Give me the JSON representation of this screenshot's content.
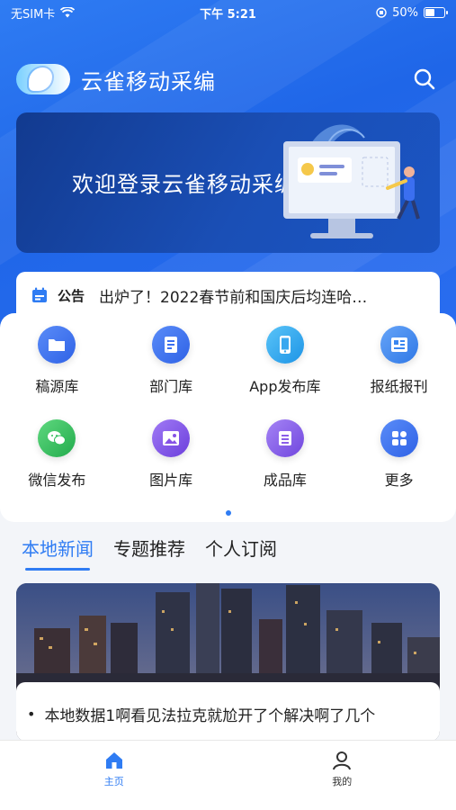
{
  "status_bar": {
    "carrier": "无SIM卡",
    "time": "下午 5:21",
    "battery": "50%",
    "battery_level": 0.5
  },
  "header": {
    "title": "云雀移动采编",
    "logo_icon": "lark-bird-logo",
    "search_icon": "search-icon"
  },
  "banner": {
    "text": "欢迎登录云雀移动采编"
  },
  "notice": {
    "tag": "公告",
    "text": "出炉了！2022春节前和国庆后均连哈…"
  },
  "grid": {
    "items": [
      {
        "label": "稿源库",
        "icon": "folder-icon",
        "color": "#3b6ff0"
      },
      {
        "label": "部门库",
        "icon": "document-icon",
        "color": "#3b6ff0"
      },
      {
        "label": "App发布库",
        "icon": "phone-icon",
        "color": "#2da5ee"
      },
      {
        "label": "报纸报刊",
        "icon": "newspaper-icon",
        "color": "#3a86f0"
      },
      {
        "label": "微信发布",
        "icon": "wechat-icon",
        "color": "#2fbd5a"
      },
      {
        "label": "图片库",
        "icon": "image-icon",
        "color": "#8652e6"
      },
      {
        "label": "成品库",
        "icon": "archive-icon",
        "color": "#8a5ee8"
      },
      {
        "label": "更多",
        "icon": "more-grid-icon",
        "color": "#3b6ff0"
      }
    ]
  },
  "tabs": [
    {
      "label": "本地新闻",
      "active": true
    },
    {
      "label": "专题推荐",
      "active": false
    },
    {
      "label": "个人订阅",
      "active": false
    }
  ],
  "news": {
    "bullet": "•",
    "title": "本地数据1啊看见法拉克就尬开了个解决啊了几个"
  },
  "bottom_nav": [
    {
      "label": "主页",
      "icon": "home-icon",
      "active": true
    },
    {
      "label": "我的",
      "icon": "user-icon",
      "active": false
    }
  ],
  "colors": {
    "primary": "#2f7cf3",
    "banner_dark": "#123a8f"
  }
}
